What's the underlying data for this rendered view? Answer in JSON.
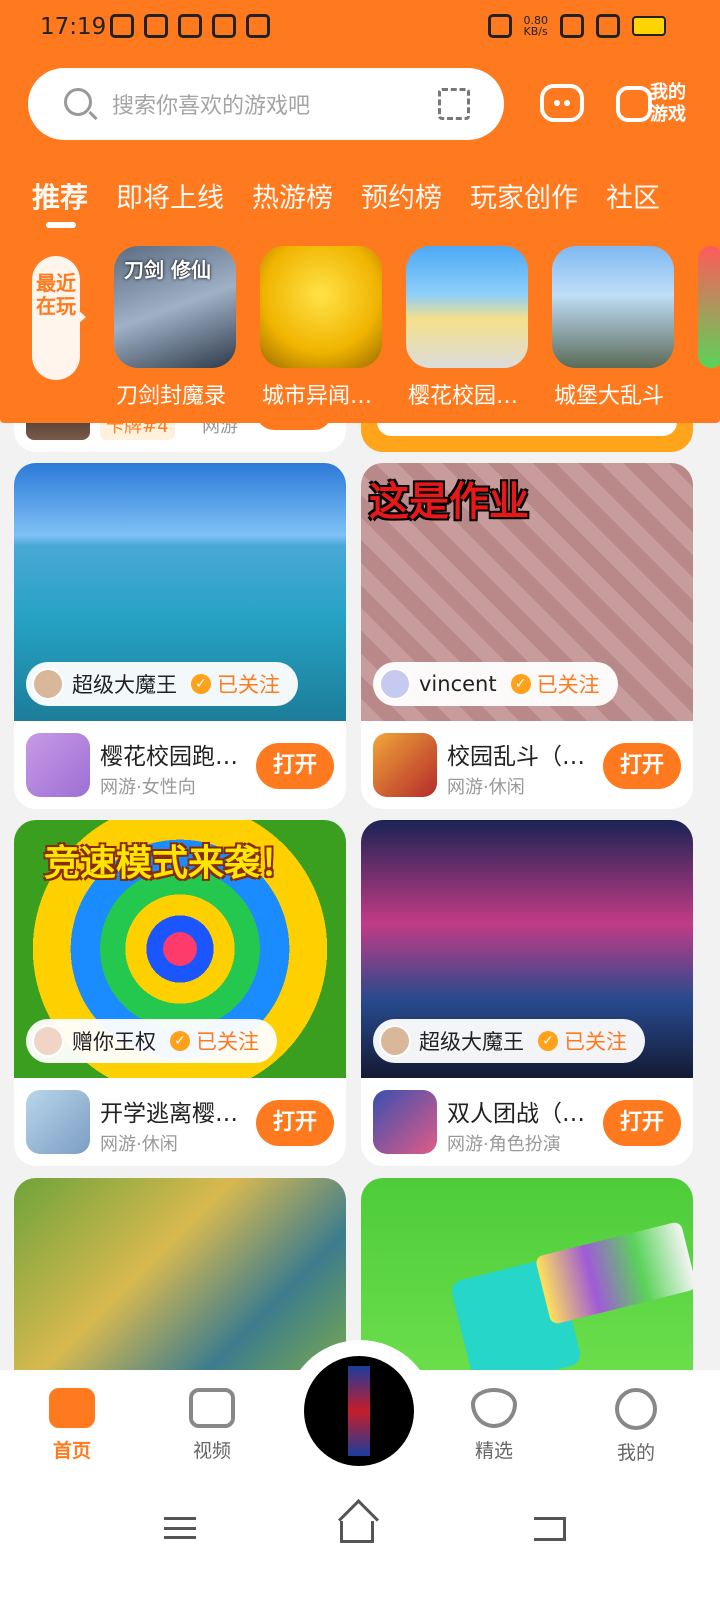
{
  "status": {
    "time": "17:19",
    "speed": "0.80",
    "speed_unit": "KB/s"
  },
  "search": {
    "placeholder": "搜索你喜欢的游戏吧"
  },
  "header": {
    "my_games_label": "我的游戏"
  },
  "tabs": [
    {
      "label": "推荐",
      "active": true
    },
    {
      "label": "即将上线"
    },
    {
      "label": "热游榜"
    },
    {
      "label": "预约榜"
    },
    {
      "label": "玩家创作"
    },
    {
      "label": "社区"
    }
  ],
  "recent": {
    "label": "最近在玩",
    "items": [
      {
        "name": "刀剑封魔录",
        "cover_text": "刀剑 修仙"
      },
      {
        "name": "城市异闻…"
      },
      {
        "name": "樱花校园…"
      },
      {
        "name": "城堡大乱斗"
      }
    ]
  },
  "partial_card": {
    "badge": "卡牌#4",
    "tag": "网游"
  },
  "cards": [
    {
      "uploader": "超级大魔王",
      "follow": "已关注",
      "game": "樱花校园跑…",
      "tags": "网游·女性向",
      "open": "打开"
    },
    {
      "uploader": "vincent",
      "follow": "已关注",
      "game": "校园乱斗（…",
      "tags": "网游·休闲",
      "open": "打开",
      "cover_text": "这是作业"
    },
    {
      "uploader": "赠你王权",
      "follow": "已关注",
      "game": "开学逃离樱…",
      "tags": "网游·休闲",
      "open": "打开",
      "cover_text": "竞速模式来袭！"
    },
    {
      "uploader": "超级大魔王",
      "follow": "已关注",
      "game": "双人团战（…",
      "tags": "网游·角色扮演",
      "open": "打开"
    }
  ],
  "bottom_nav": [
    {
      "label": "首页",
      "active": true
    },
    {
      "label": "视频"
    },
    {
      "label": "精选"
    },
    {
      "label": "我的"
    }
  ],
  "colors": {
    "accent": "#ff7a1f"
  }
}
